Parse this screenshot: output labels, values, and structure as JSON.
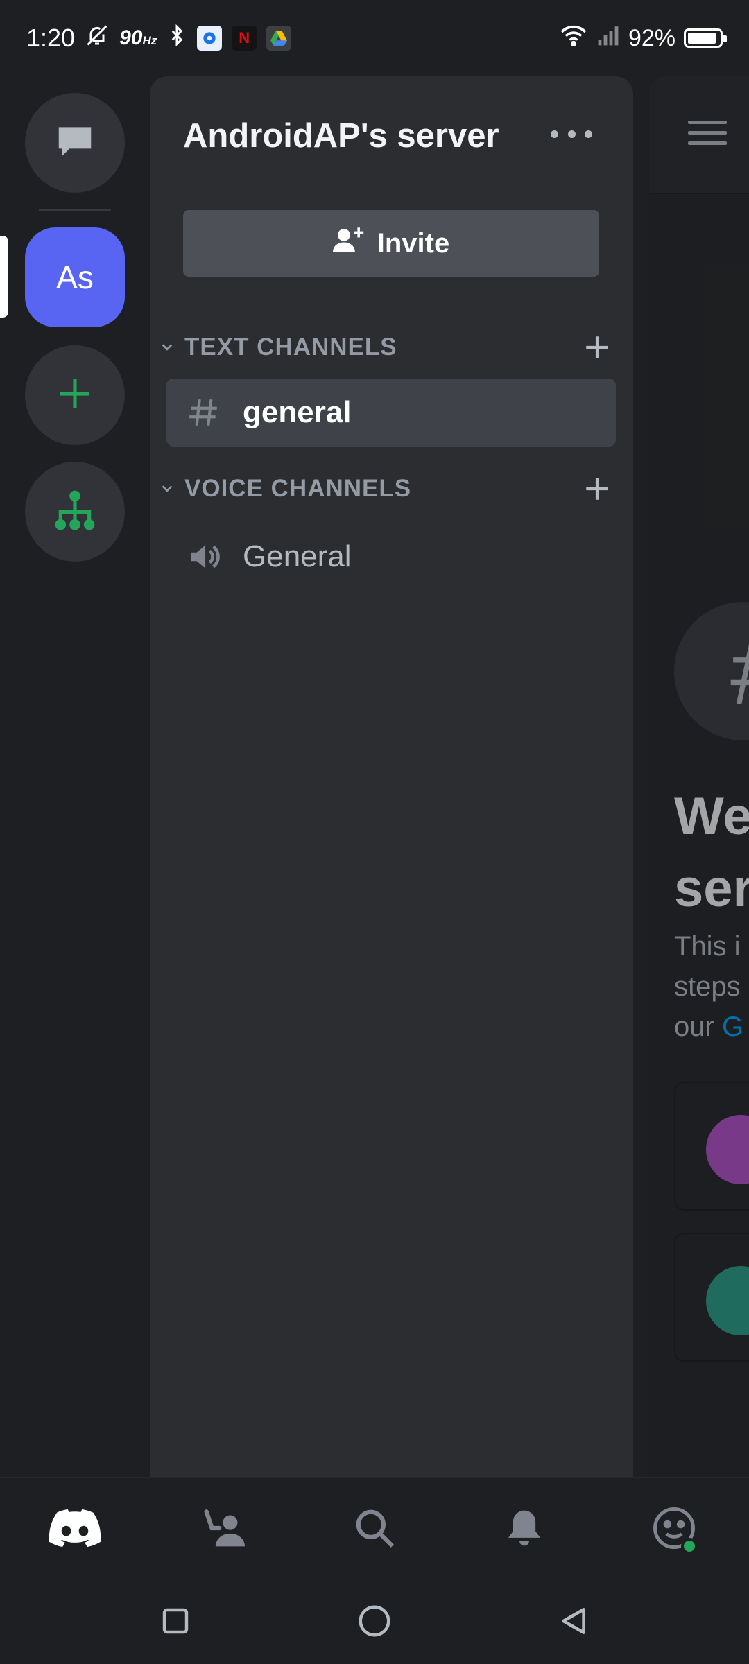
{
  "status_bar": {
    "time": "1:20",
    "refresh_rate": "90",
    "refresh_unit": "Hz",
    "battery_percent": "92%",
    "battery_level": 0.92,
    "app_icons": [
      "settings-app-icon",
      "netflix-app-icon",
      "drive-app-icon"
    ],
    "netflix_letter": "N"
  },
  "rail": {
    "active_server_initials": "As",
    "items": [
      "direct-messages",
      "AndroidAP's server",
      "add-server",
      "discover-servers"
    ]
  },
  "server": {
    "name": "AndroidAP's server",
    "invite_label": "Invite"
  },
  "categories": {
    "text": {
      "label": "TEXT CHANNELS",
      "channels": [
        {
          "name": "general",
          "active": true
        }
      ]
    },
    "voice": {
      "label": "VOICE CHANNELS",
      "channels": [
        {
          "name": "General",
          "active": false
        }
      ]
    }
  },
  "peek": {
    "welcome_fragment": "We\nser",
    "desc_line1": "This i",
    "desc_line2": "steps",
    "desc_line3_prefix": "our ",
    "desc_line3_link": "G"
  },
  "colors": {
    "accent": "#5865f2",
    "green": "#23a55a",
    "panel": "#2b2d31",
    "rail": "#1e1f22"
  }
}
